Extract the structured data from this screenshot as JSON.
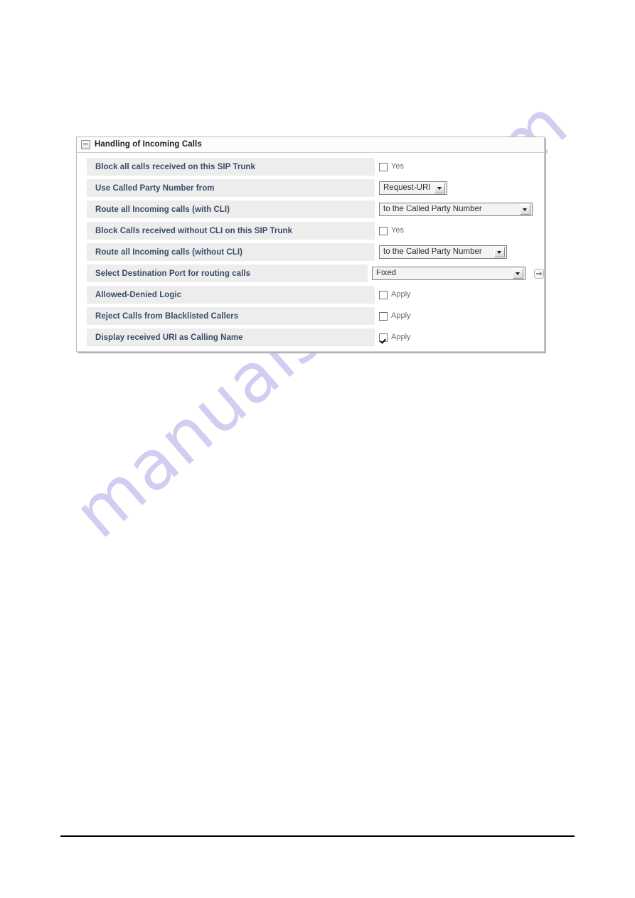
{
  "page": {
    "background_color": "#ffffff",
    "watermark": "manualshive.com",
    "watermark_color": "#c9c6ef",
    "footer_rule_color": "#000000"
  },
  "panel": {
    "title": "Handling of Incoming Calls",
    "collapse_icon": "minus-box-icon",
    "label_color": "#3b4a6b",
    "row_background": "#ededed",
    "rows": [
      {
        "label": "Block all calls received on this SIP Trunk",
        "control": "checkbox",
        "control_label": "Yes",
        "checked": false
      },
      {
        "label": "Use Called Party Number from",
        "control": "select",
        "value": "Request-URI",
        "width": "small"
      },
      {
        "label": "Route all Incoming calls (with CLI)",
        "control": "select",
        "value": "to the Called Party Number",
        "width": "large"
      },
      {
        "label": "Block Calls received without CLI on this SIP Trunk",
        "control": "checkbox",
        "control_label": "Yes",
        "checked": false
      },
      {
        "label": "Route all Incoming calls (without CLI)",
        "control": "select",
        "value": "to the Called Party Number",
        "width": "medium"
      },
      {
        "label": "Select Destination Port for routing calls",
        "control": "select",
        "value": "Fixed",
        "width": "large",
        "go_button": true,
        "go_button_icon": "arrow-right-icon"
      },
      {
        "label": "Allowed-Denied Logic",
        "control": "checkbox",
        "control_label": "Apply",
        "checked": false
      },
      {
        "label": "Reject Calls from Blacklisted Callers",
        "control": "checkbox",
        "control_label": "Apply",
        "checked": false
      },
      {
        "label": "Display received URI as Calling Name",
        "control": "checkbox",
        "control_label": "Apply",
        "checked": true
      }
    ]
  }
}
